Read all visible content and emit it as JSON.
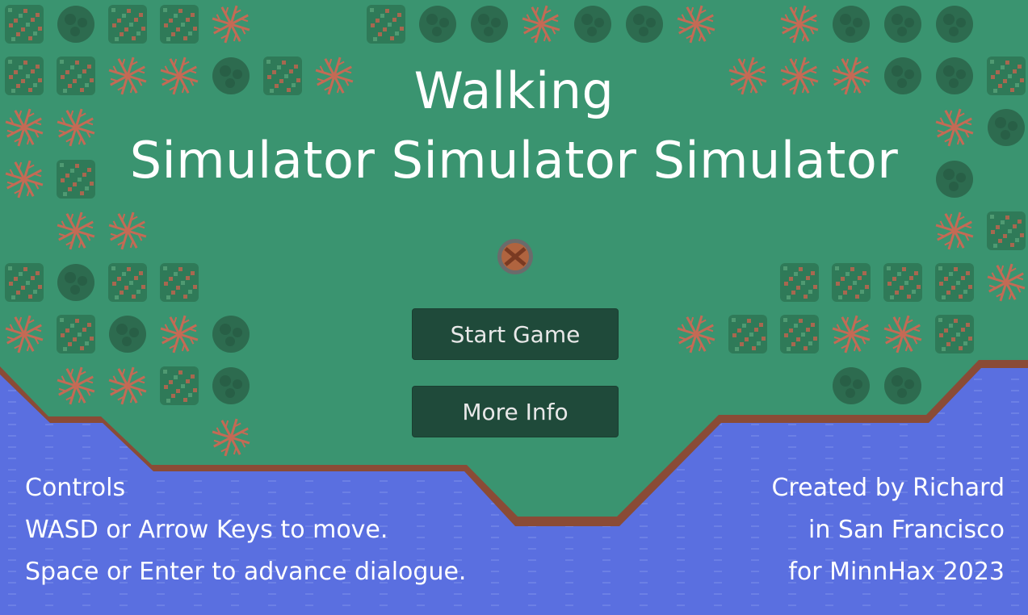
{
  "title": {
    "line1": "Walking",
    "line2": "Simulator Simulator Simulator"
  },
  "menu": {
    "start_label": "Start Game",
    "info_label": "More Info"
  },
  "controls": {
    "heading": "Controls",
    "move": "WASD or Arrow Keys to move.",
    "advance": "Space or Enter to advance dialogue."
  },
  "credits": {
    "line1": "Created by Richard",
    "line2": "in San Francisco",
    "line3": "for MinnHax 2023"
  },
  "colors": {
    "grass": "#3a9470",
    "water": "#5a6fe0",
    "shore": "#8a4b36",
    "button": "#1f4a3a",
    "coral": "#c46a55",
    "rock": "#2d6b4f"
  }
}
